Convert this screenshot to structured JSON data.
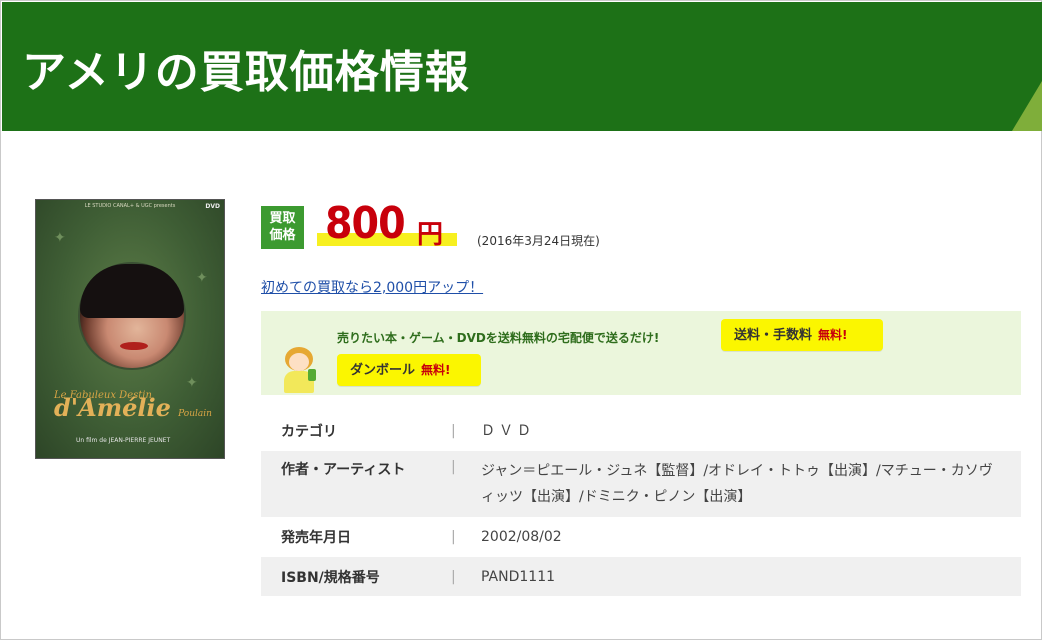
{
  "header": {
    "title": "アメリの買取価格情報"
  },
  "product": {
    "cover": {
      "top_text": "LE STUDIO CANAL+ & UGC presents",
      "dvd_label": "DVD",
      "title_line1": "Le Fabuleux Destin",
      "title_line2": "d'Amélie",
      "title_line3": "Poulain",
      "director": "Un film de JEAN-PIERRE JEUNET"
    }
  },
  "price": {
    "badge_line1": "買取",
    "badge_line2": "価格",
    "value": "800",
    "unit": "円",
    "date": "(2016年3月24日現在)"
  },
  "promo": {
    "first_time_link": "初めての買取なら2,000円アップ！"
  },
  "banner": {
    "text": "売りたい本・ゲーム・DVDを送料無料の宅配便で送るだけ!",
    "shipping_label": "送料・手数料",
    "shipping_free": "無料!",
    "box_label": "ダンボール",
    "box_free": "無料!"
  },
  "info": {
    "rows": [
      {
        "key": "カテゴリ",
        "sep": "|",
        "value": "ＤＶＤ"
      },
      {
        "key": "作者・アーティスト",
        "sep": "|",
        "value": "ジャン＝ピエール・ジュネ【監督】/オドレイ・トトゥ【出演】/マチュー・カソヴィッツ【出演】/ドミニク・ピノン【出演】"
      },
      {
        "key": "発売年月日",
        "sep": "|",
        "value": "2002/08/02"
      },
      {
        "key": "ISBN/規格番号",
        "sep": "|",
        "value": "PAND1111"
      }
    ]
  },
  "colors": {
    "header_bg": "#1d7117",
    "price_red": "#c8000b",
    "badge_green": "#3c9a30",
    "highlight_yellow": "#f7f020",
    "banner_bg": "#ebf6dc",
    "tag_yellow": "#fbf600",
    "link_blue": "#1f4fa8"
  }
}
